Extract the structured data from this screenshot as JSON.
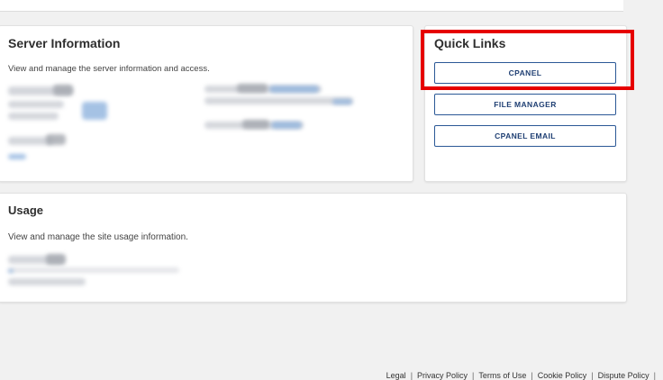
{
  "server_info": {
    "title": "Server Information",
    "description": "View and manage the server information and access."
  },
  "quick_links": {
    "title": "Quick Links",
    "buttons": [
      "CPANEL",
      "FILE MANAGER",
      "CPANEL EMAIL"
    ]
  },
  "usage": {
    "title": "Usage",
    "description": "View and manage the site usage information."
  },
  "footer": {
    "links": [
      "Legal",
      "Privacy Policy",
      "Terms of Use",
      "Cookie Policy",
      "Dispute Policy"
    ],
    "separator": "|"
  },
  "colors": {
    "accent": "#1f3f73",
    "highlight": "#e60000",
    "background": "#f1f1f1"
  }
}
